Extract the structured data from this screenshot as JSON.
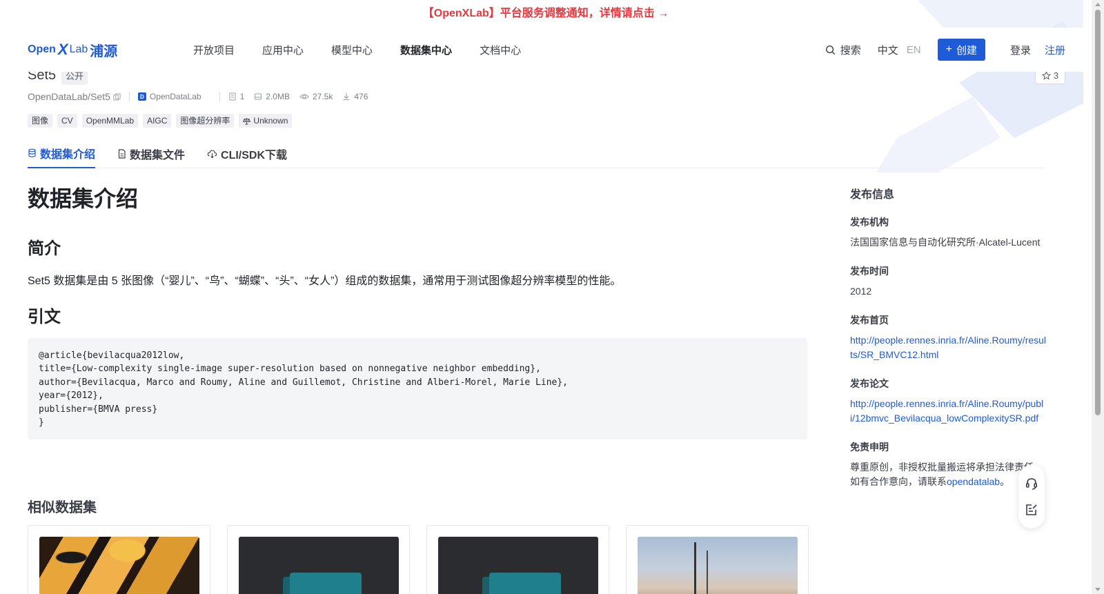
{
  "notice": "【OpenXLab】平台服务调整通知，详情请点击 →",
  "logo": {
    "part1": "Open",
    "x": "X",
    "part2": "Lab",
    "cn": "浦源"
  },
  "nav": [
    "开放项目",
    "应用中心",
    "模型中心",
    "数据集中心",
    "文档中心"
  ],
  "header": {
    "search": "搜索",
    "lang_cn": "中文",
    "lang_en": "EN",
    "create": "创建",
    "login": "登录",
    "register": "注册"
  },
  "dataset": {
    "name": "Set5",
    "visibility": "公开",
    "stars": "3",
    "path": "OpenDataLab/Set5",
    "org": "OpenDataLab",
    "files": "1",
    "size": "2.0MB",
    "views": "27.5k",
    "downloads": "476",
    "tags": [
      "图像",
      "CV",
      "OpenMMLab",
      "AIGC",
      "图像超分辨率"
    ],
    "license": "Unknown"
  },
  "tabs": [
    "数据集介绍",
    "数据集文件",
    "CLI/SDK下载"
  ],
  "content": {
    "h1": "数据集介绍",
    "intro_heading": "简介",
    "intro_text": "Set5 数据集是由 5 张图像（“婴儿”、“鸟”、“蝴蝶”、“头”、“女人”）组成的数据集，通常用于测试图像超分辨率模型的性能。",
    "citation_heading": "引文",
    "citation": "@article{bevilacqua2012low,\ntitle={Low-complexity single-image super-resolution based on nonnegative neighbor embedding},\nauthor={Bevilacqua, Marco and Roumy, Aline and Guillemot, Christine and Alberi-Morel, Marie Line},\nyear={2012},\npublisher={BMVA press}\n}",
    "similar_heading": "相似数据集"
  },
  "sidebar": {
    "title": "发布信息",
    "org_label": "发布机构",
    "org_value": "法国国家信息与自动化研究所·Alcatel-Lucent",
    "time_label": "发布时间",
    "time_value": "2012",
    "home_label": "发布首页",
    "home_url": "http://people.rennes.inria.fr/Aline.Roumy/results/SR_BMVC12.html",
    "paper_label": "发布论文",
    "paper_url": "http://people.rennes.inria.fr/Aline.Roumy/publi/12bmvc_Bevilacqua_lowComplexitySR.pdf",
    "disclaimer_label": "免责申明",
    "disclaimer_line1": "尊重原创，非授权批量搬运将承担法律责任",
    "disclaimer_line2_prefix": "如有合作意向，请联系",
    "disclaimer_link": "opendatalab",
    "disclaimer_line2_suffix": "。"
  },
  "colors": {
    "accent": "#1e5bd8",
    "notice": "#e8363d"
  },
  "icons": [
    "search-icon",
    "star-icon",
    "copy-icon",
    "file-icon",
    "disk-icon",
    "eye-icon",
    "download-icon",
    "scale-icon",
    "database-icon",
    "document-icon",
    "cloud-download-icon",
    "headset-icon",
    "feedback-icon"
  ]
}
